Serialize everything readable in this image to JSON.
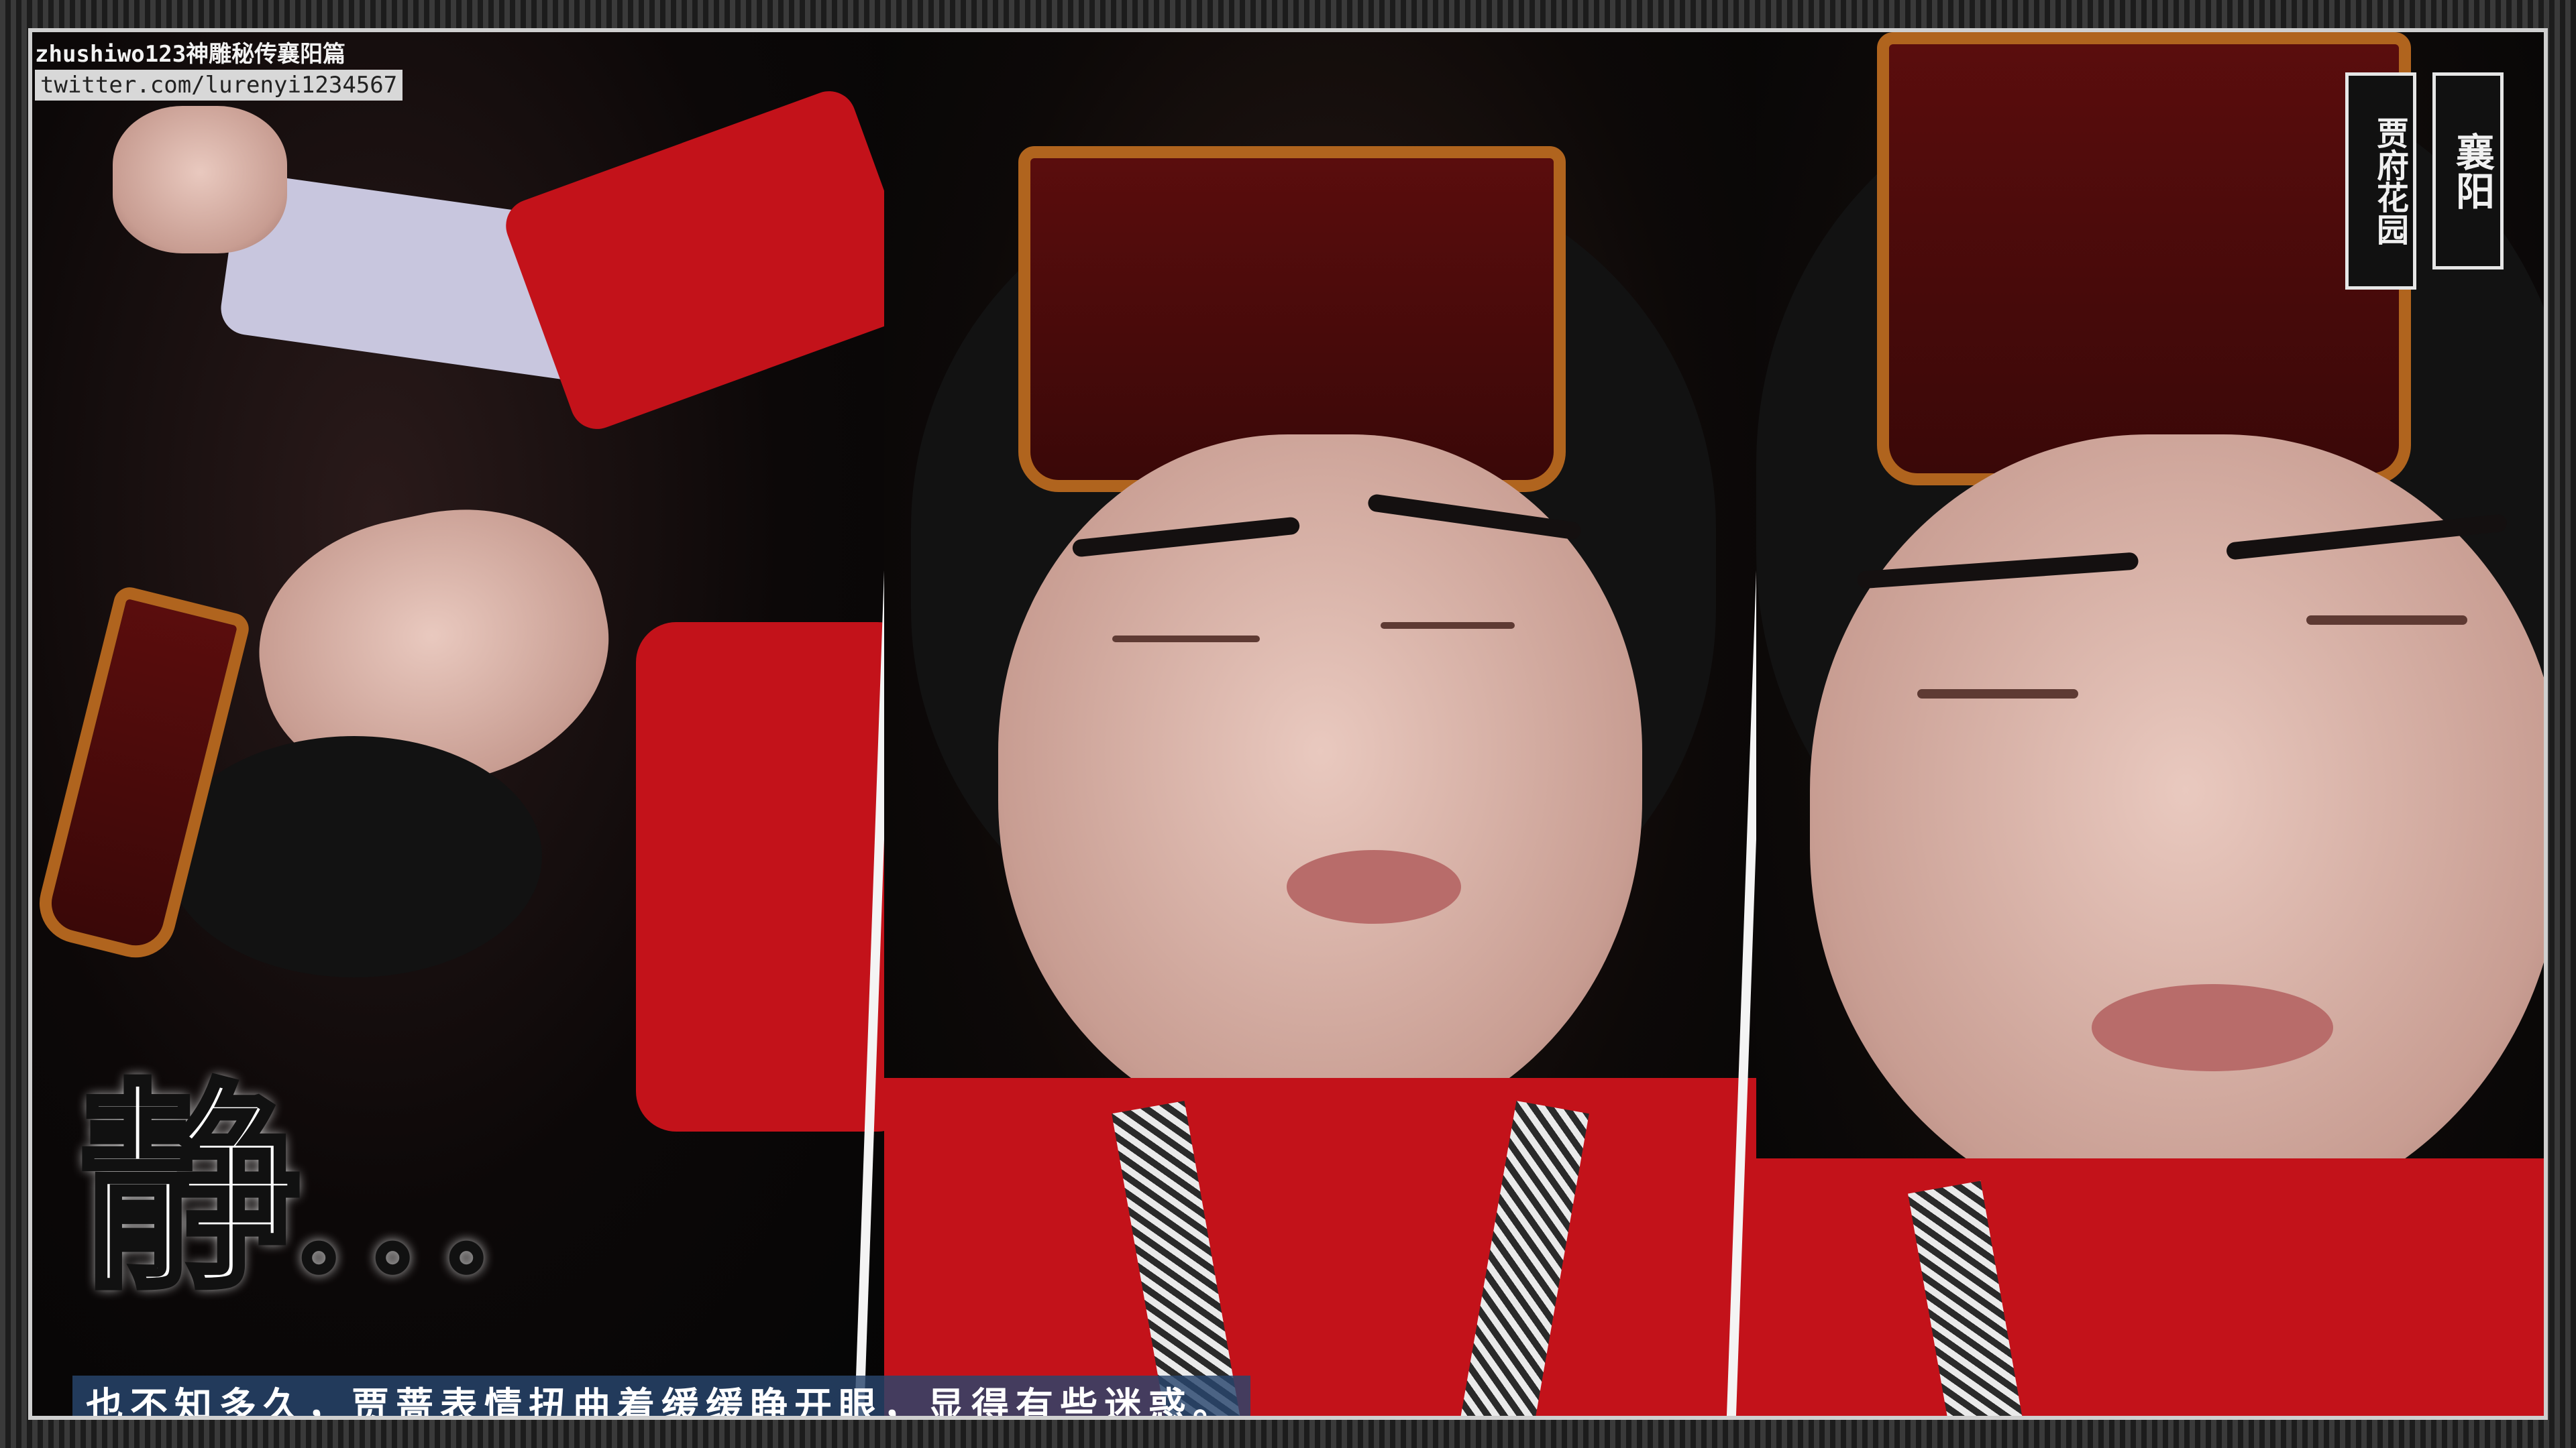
{
  "watermark": {
    "line1": "zhushiwo123神雕秘传襄阳篇",
    "line2": "twitter.com/lurenyi1234567"
  },
  "location": {
    "place": "襄阳",
    "sub": "贾府花园"
  },
  "sfx": {
    "char": "静",
    "dots": "。。。"
  },
  "caption": "也不知多久，贾蔷表情扭曲着缓缓睁开眼，显得有些迷惑。",
  "colors": {
    "robe": "#c3121a",
    "crown_gold": "#b0641e",
    "caption_bg": "#28466e"
  }
}
